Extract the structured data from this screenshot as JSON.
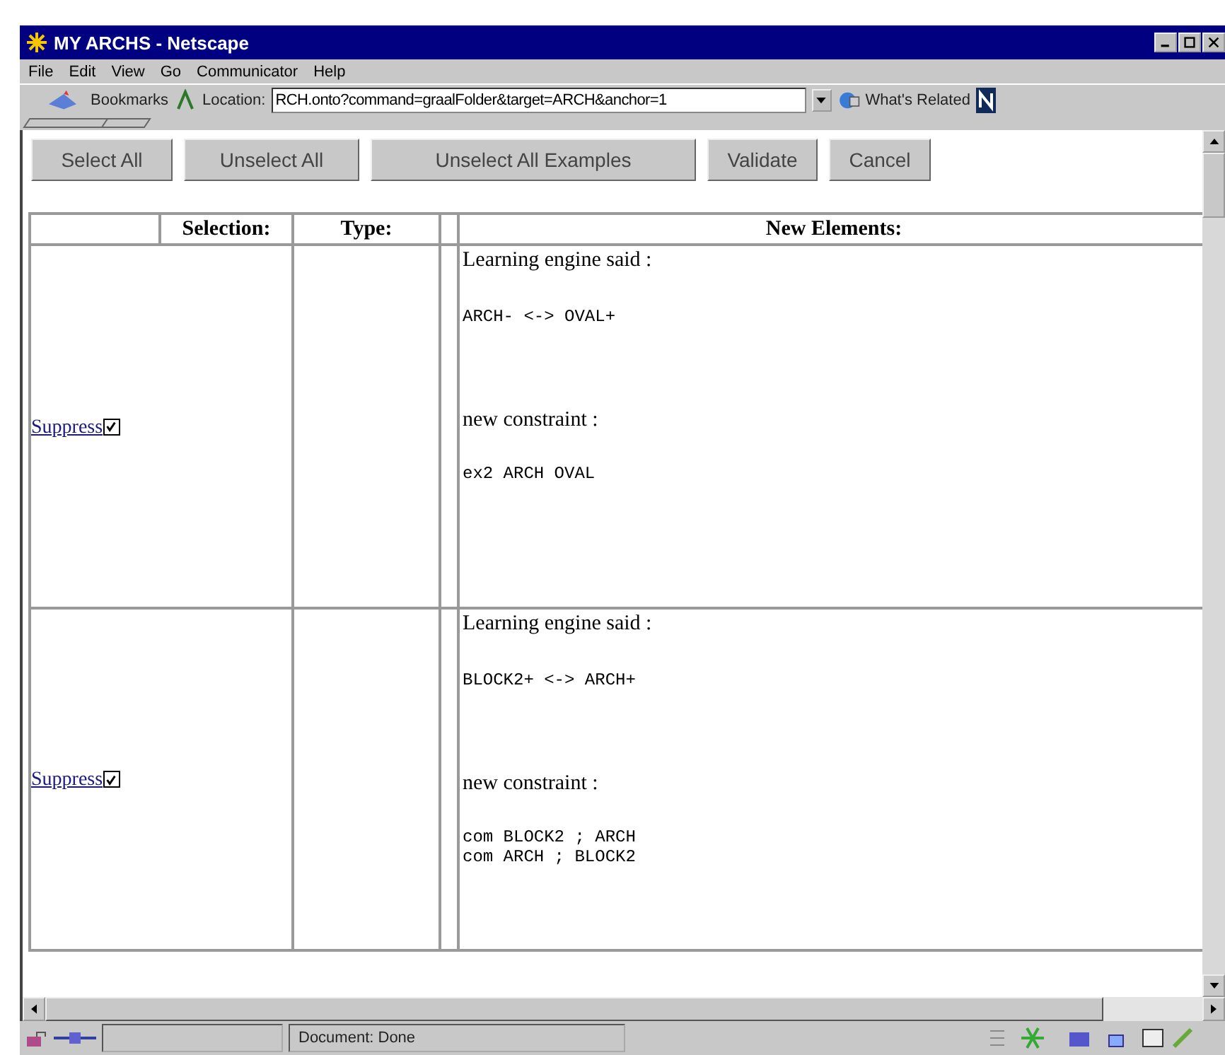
{
  "window": {
    "title": "MY ARCHS - Netscape"
  },
  "menu": [
    "File",
    "Edit",
    "View",
    "Go",
    "Communicator",
    "Help"
  ],
  "toolbar": {
    "bookmarks": "Bookmarks",
    "location_label": "Location:",
    "location": "RCH.onto?command=graalFolder&target=ARCH&anchor=1",
    "related": "What's Related"
  },
  "buttons": [
    "Select All",
    "Unselect All",
    "Unselect All Examples",
    "Validate",
    "Cancel"
  ],
  "table": {
    "columns": [
      "Selection:",
      "Type:",
      "New Elements:"
    ],
    "rows": [
      {
        "action": "Suppress",
        "checked": true,
        "said": "Learning engine said :",
        "rule": "ARCH-  <->  OVAL+",
        "constraint_label": "new constraint :",
        "constraints": [
          "ex2  ARCH  OVAL"
        ]
      },
      {
        "action": "Suppress",
        "checked": true,
        "said": "Learning engine said :",
        "rule": "BLOCK2+  <->  ARCH+",
        "constraint_label": "new constraint :",
        "constraints": [
          "com  BLOCK2  ;  ARCH",
          "com  ARCH  ;  BLOCK2"
        ]
      }
    ]
  },
  "status_bar": {
    "text": "Document: Done"
  }
}
